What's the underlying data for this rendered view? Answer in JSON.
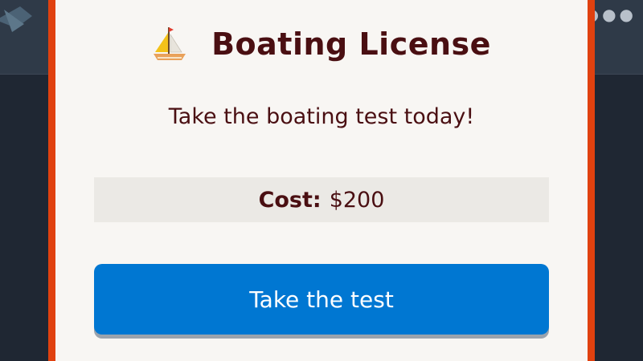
{
  "modal": {
    "icon": "sailboat-icon",
    "title": "Boating License",
    "subtitle": "Take the boating test today!",
    "cost": {
      "label": "Cost:",
      "value": "$200"
    },
    "action_button_label": "Take the test"
  },
  "background": {
    "menu_icon": "more-dots-icon"
  },
  "colors": {
    "modal_border": "#e0410f",
    "modal_background": "#f8f6f3",
    "text": "#4a0f12",
    "button": "#0077d2",
    "cost_background": "#ebe9e5"
  }
}
